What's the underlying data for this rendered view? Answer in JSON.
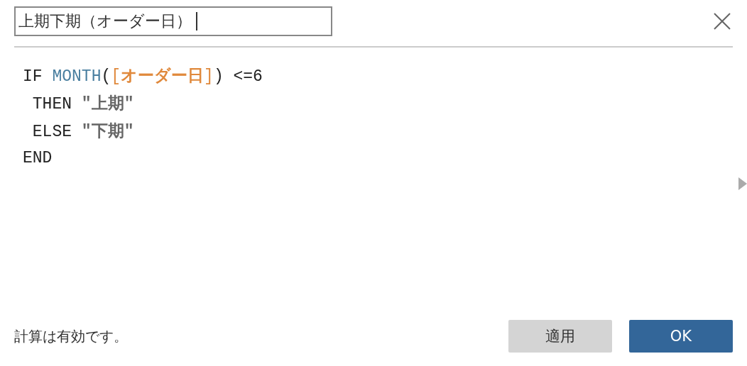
{
  "name_field": {
    "value": "上期下期（オーダー日）"
  },
  "code_lines": [
    {
      "tokens": [
        {
          "kind": "keyword",
          "text": "IF "
        },
        {
          "kind": "function",
          "text": "MONTH"
        },
        {
          "kind": "plain",
          "text": "("
        },
        {
          "kind": "bracket",
          "text": "["
        },
        {
          "kind": "field",
          "text": "オーダー日"
        },
        {
          "kind": "bracket",
          "text": "]"
        },
        {
          "kind": "plain",
          "text": ") <=6"
        }
      ]
    },
    {
      "tokens": [
        {
          "kind": "keyword",
          "text": " THEN "
        },
        {
          "kind": "quote",
          "text": "\""
        },
        {
          "kind": "string",
          "text": "上期"
        },
        {
          "kind": "quote",
          "text": "\""
        }
      ]
    },
    {
      "tokens": [
        {
          "kind": "keyword",
          "text": " ELSE "
        },
        {
          "kind": "quote",
          "text": "\""
        },
        {
          "kind": "string",
          "text": "下期"
        },
        {
          "kind": "quote",
          "text": "\""
        }
      ]
    },
    {
      "tokens": [
        {
          "kind": "keyword",
          "text": "END"
        }
      ]
    }
  ],
  "status": "計算は有効です。",
  "buttons": [
    {
      "label": "適用",
      "kind": "secondary"
    },
    {
      "label": "OK",
      "kind": "primary"
    }
  ]
}
